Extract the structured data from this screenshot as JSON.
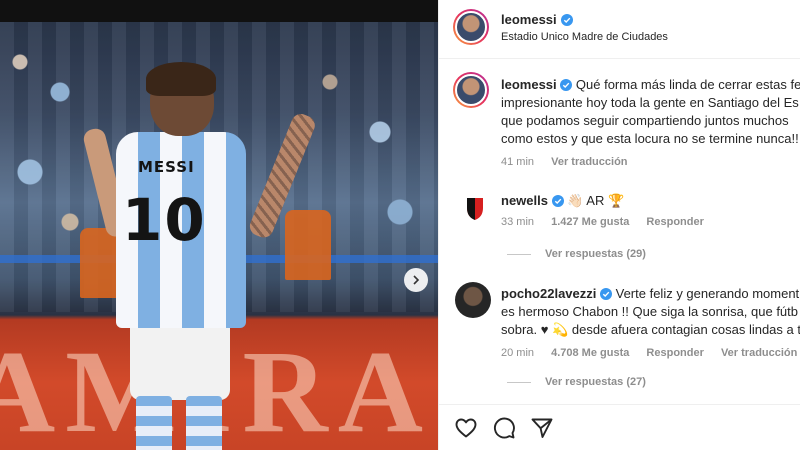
{
  "post": {
    "author": "leomessi",
    "location": "Estadio Unico Madre de Ciudades"
  },
  "photo": {
    "jersey_name": "MESSI",
    "jersey_number": "10",
    "board_text": "AMIRA"
  },
  "caption": {
    "username": "leomessi",
    "lines": [
      "Qué forma más linda de cerrar estas fec",
      "impresionante hoy toda la gente en Santiago del Es",
      "que podamos seguir compartiendo juntos muchos",
      "como estos y que esta locura no se termine nunca!!"
    ],
    "time": "41 min",
    "translate": "Ver traducción"
  },
  "comments": [
    {
      "username": "newells",
      "text": "👋🏻 AR 🏆",
      "time": "33 min",
      "likes": "1.427 Me gusta",
      "reply": "Responder",
      "view_replies": "Ver respuestas (29)"
    },
    {
      "username": "pocho22lavezzi",
      "lines": [
        "Verte feliz y generando moment",
        "es hermoso Chabon !! Que siga la sonrisa, que fútb",
        "sobra. ♥ 💫 desde afuera contagian cosas lindas a t"
      ],
      "time": "20 min",
      "likes": "4.708 Me gusta",
      "reply": "Responder",
      "translate": "Ver traducción",
      "view_replies": "Ver respuestas (27)"
    }
  ],
  "actions": {
    "like_icon": "heart-icon",
    "comment_icon": "comment-icon",
    "share_icon": "share-icon"
  },
  "colors": {
    "verified": "#3897f0",
    "muted": "#8e8e8e",
    "text": "#262626"
  }
}
